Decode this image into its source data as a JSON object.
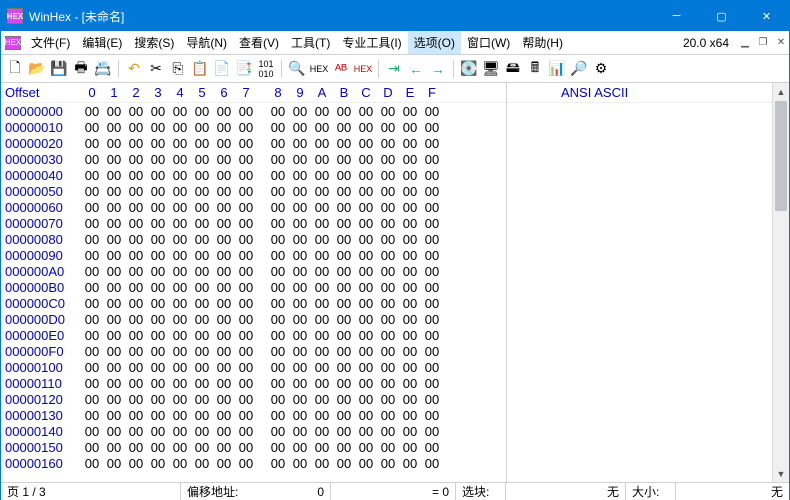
{
  "title": "WinHex - [未命名]",
  "version": "20.0 x64",
  "menu": {
    "items": [
      "文件(F)",
      "编辑(E)",
      "搜索(S)",
      "导航(N)",
      "查看(V)",
      "工具(T)",
      "专业工具(I)",
      "选项(O)",
      "窗口(W)",
      "帮助(H)"
    ],
    "selected": 7
  },
  "hex": {
    "offset_label": "Offset",
    "cols": [
      "0",
      "1",
      "2",
      "3",
      "4",
      "5",
      "6",
      "7",
      "8",
      "9",
      "A",
      "B",
      "C",
      "D",
      "E",
      "F"
    ],
    "offsets": [
      "00000000",
      "00000010",
      "00000020",
      "00000030",
      "00000040",
      "00000050",
      "00000060",
      "00000070",
      "00000080",
      "00000090",
      "000000A0",
      "000000B0",
      "000000C0",
      "000000D0",
      "000000E0",
      "000000F0",
      "00000100",
      "00000110",
      "00000120",
      "00000130",
      "00000140",
      "00000150",
      "00000160"
    ],
    "byte": "00"
  },
  "ansi_label": "ANSI ASCII",
  "status": {
    "page": "页 1 / 3",
    "offset_label": "偏移地址:",
    "offset_value": "0",
    "eq": "= 0",
    "sel_label": "选块:",
    "none1": "无",
    "size_label": "大小:",
    "none2": "无"
  }
}
